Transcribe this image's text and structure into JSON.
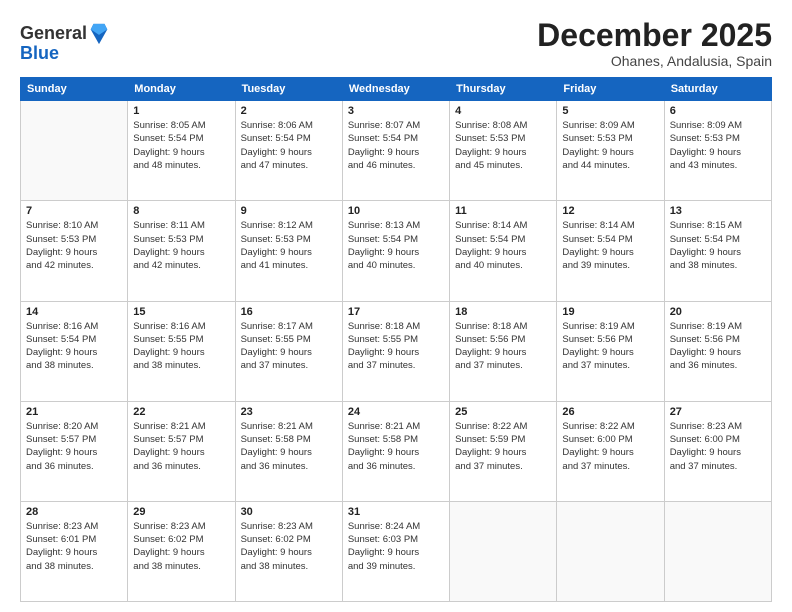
{
  "header": {
    "logo_line1": "General",
    "logo_line2": "Blue",
    "title": "December 2025",
    "subtitle": "Ohanes, Andalusia, Spain"
  },
  "weekdays": [
    "Sunday",
    "Monday",
    "Tuesday",
    "Wednesday",
    "Thursday",
    "Friday",
    "Saturday"
  ],
  "weeks": [
    [
      {
        "day": "",
        "info": ""
      },
      {
        "day": "1",
        "info": "Sunrise: 8:05 AM\nSunset: 5:54 PM\nDaylight: 9 hours\nand 48 minutes."
      },
      {
        "day": "2",
        "info": "Sunrise: 8:06 AM\nSunset: 5:54 PM\nDaylight: 9 hours\nand 47 minutes."
      },
      {
        "day": "3",
        "info": "Sunrise: 8:07 AM\nSunset: 5:54 PM\nDaylight: 9 hours\nand 46 minutes."
      },
      {
        "day": "4",
        "info": "Sunrise: 8:08 AM\nSunset: 5:53 PM\nDaylight: 9 hours\nand 45 minutes."
      },
      {
        "day": "5",
        "info": "Sunrise: 8:09 AM\nSunset: 5:53 PM\nDaylight: 9 hours\nand 44 minutes."
      },
      {
        "day": "6",
        "info": "Sunrise: 8:09 AM\nSunset: 5:53 PM\nDaylight: 9 hours\nand 43 minutes."
      }
    ],
    [
      {
        "day": "7",
        "info": "Sunrise: 8:10 AM\nSunset: 5:53 PM\nDaylight: 9 hours\nand 42 minutes."
      },
      {
        "day": "8",
        "info": "Sunrise: 8:11 AM\nSunset: 5:53 PM\nDaylight: 9 hours\nand 42 minutes."
      },
      {
        "day": "9",
        "info": "Sunrise: 8:12 AM\nSunset: 5:53 PM\nDaylight: 9 hours\nand 41 minutes."
      },
      {
        "day": "10",
        "info": "Sunrise: 8:13 AM\nSunset: 5:54 PM\nDaylight: 9 hours\nand 40 minutes."
      },
      {
        "day": "11",
        "info": "Sunrise: 8:14 AM\nSunset: 5:54 PM\nDaylight: 9 hours\nand 40 minutes."
      },
      {
        "day": "12",
        "info": "Sunrise: 8:14 AM\nSunset: 5:54 PM\nDaylight: 9 hours\nand 39 minutes."
      },
      {
        "day": "13",
        "info": "Sunrise: 8:15 AM\nSunset: 5:54 PM\nDaylight: 9 hours\nand 38 minutes."
      }
    ],
    [
      {
        "day": "14",
        "info": "Sunrise: 8:16 AM\nSunset: 5:54 PM\nDaylight: 9 hours\nand 38 minutes."
      },
      {
        "day": "15",
        "info": "Sunrise: 8:16 AM\nSunset: 5:55 PM\nDaylight: 9 hours\nand 38 minutes."
      },
      {
        "day": "16",
        "info": "Sunrise: 8:17 AM\nSunset: 5:55 PM\nDaylight: 9 hours\nand 37 minutes."
      },
      {
        "day": "17",
        "info": "Sunrise: 8:18 AM\nSunset: 5:55 PM\nDaylight: 9 hours\nand 37 minutes."
      },
      {
        "day": "18",
        "info": "Sunrise: 8:18 AM\nSunset: 5:56 PM\nDaylight: 9 hours\nand 37 minutes."
      },
      {
        "day": "19",
        "info": "Sunrise: 8:19 AM\nSunset: 5:56 PM\nDaylight: 9 hours\nand 37 minutes."
      },
      {
        "day": "20",
        "info": "Sunrise: 8:19 AM\nSunset: 5:56 PM\nDaylight: 9 hours\nand 36 minutes."
      }
    ],
    [
      {
        "day": "21",
        "info": "Sunrise: 8:20 AM\nSunset: 5:57 PM\nDaylight: 9 hours\nand 36 minutes."
      },
      {
        "day": "22",
        "info": "Sunrise: 8:21 AM\nSunset: 5:57 PM\nDaylight: 9 hours\nand 36 minutes."
      },
      {
        "day": "23",
        "info": "Sunrise: 8:21 AM\nSunset: 5:58 PM\nDaylight: 9 hours\nand 36 minutes."
      },
      {
        "day": "24",
        "info": "Sunrise: 8:21 AM\nSunset: 5:58 PM\nDaylight: 9 hours\nand 36 minutes."
      },
      {
        "day": "25",
        "info": "Sunrise: 8:22 AM\nSunset: 5:59 PM\nDaylight: 9 hours\nand 37 minutes."
      },
      {
        "day": "26",
        "info": "Sunrise: 8:22 AM\nSunset: 6:00 PM\nDaylight: 9 hours\nand 37 minutes."
      },
      {
        "day": "27",
        "info": "Sunrise: 8:23 AM\nSunset: 6:00 PM\nDaylight: 9 hours\nand 37 minutes."
      }
    ],
    [
      {
        "day": "28",
        "info": "Sunrise: 8:23 AM\nSunset: 6:01 PM\nDaylight: 9 hours\nand 38 minutes."
      },
      {
        "day": "29",
        "info": "Sunrise: 8:23 AM\nSunset: 6:02 PM\nDaylight: 9 hours\nand 38 minutes."
      },
      {
        "day": "30",
        "info": "Sunrise: 8:23 AM\nSunset: 6:02 PM\nDaylight: 9 hours\nand 38 minutes."
      },
      {
        "day": "31",
        "info": "Sunrise: 8:24 AM\nSunset: 6:03 PM\nDaylight: 9 hours\nand 39 minutes."
      },
      {
        "day": "",
        "info": ""
      },
      {
        "day": "",
        "info": ""
      },
      {
        "day": "",
        "info": ""
      }
    ]
  ]
}
